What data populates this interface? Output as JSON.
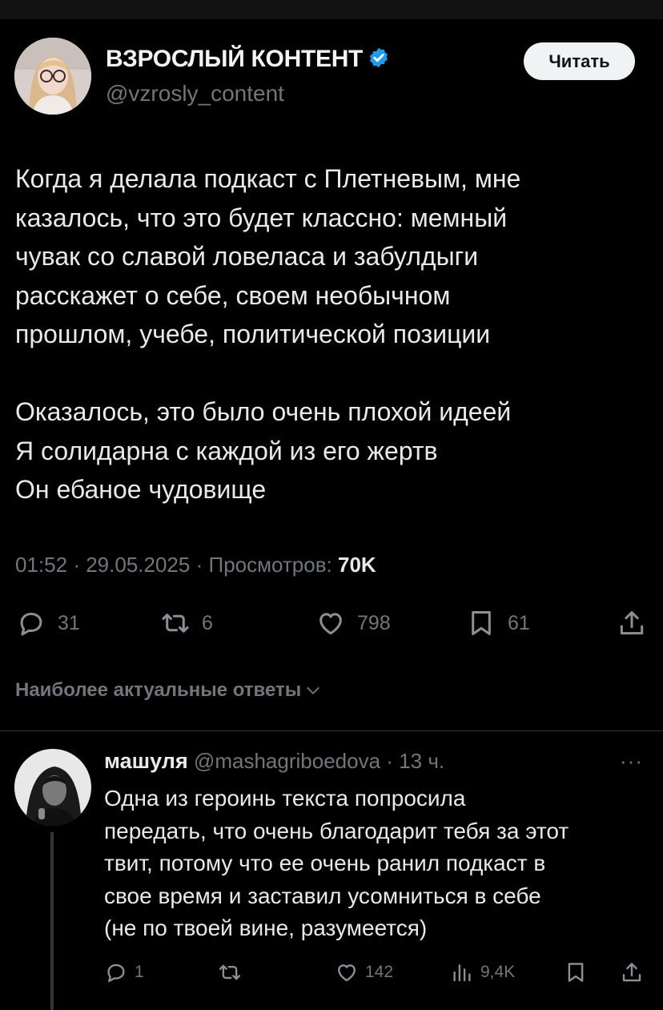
{
  "author": {
    "name": "ВЗРОСЛЫЙ КОНТЕНТ",
    "handle": "@vzrosly_content",
    "follow_label": "Читать"
  },
  "tweet": {
    "paragraph1": [
      "Когда я делала подкаст с Плетневым, мне",
      "казалось, что это будет классно: мемный",
      "чувак со славой ловеласа и забулдыги",
      "расскажет о себе, своем необычном",
      "прошлом, учебе, политической позиции"
    ],
    "paragraph2": [
      "Оказалось, это было очень плохой идеей",
      "Я солидарна с каждой из его жертв",
      "Он ебаное чудовище"
    ],
    "time": "01:52",
    "date": "29.05.2025",
    "views_label": "Просмотров:",
    "views": "70K",
    "separator": "·",
    "replies": "31",
    "retweets": "6",
    "likes": "798",
    "bookmarks": "61"
  },
  "sort": {
    "label": "Наиболее актуальные ответы"
  },
  "reply": {
    "name": "машуля",
    "handle": "@mashagriboedova",
    "time": "13 ч.",
    "more": "···",
    "lines": [
      "Одна из героинь текста попросила",
      "передать, что очень благодарит тебя за этот",
      "твит, потому что ее очень ранил подкаст в",
      "свое время и заставил усомниться в себе",
      "(не по твоей вине, разумеется)"
    ],
    "replies": "1",
    "retweets": "",
    "likes": "142",
    "views": "9,4K"
  },
  "colors": {
    "background": "#000000",
    "text": "#e7e9ea",
    "muted": "#71767b",
    "verified": "#1d9bf0",
    "divider": "#2f3336"
  },
  "icons": [
    "verified-badge-icon",
    "reply-icon",
    "retweet-icon",
    "like-icon",
    "bookmark-icon",
    "share-icon",
    "chevron-down-icon",
    "views-icon",
    "more-icon"
  ]
}
